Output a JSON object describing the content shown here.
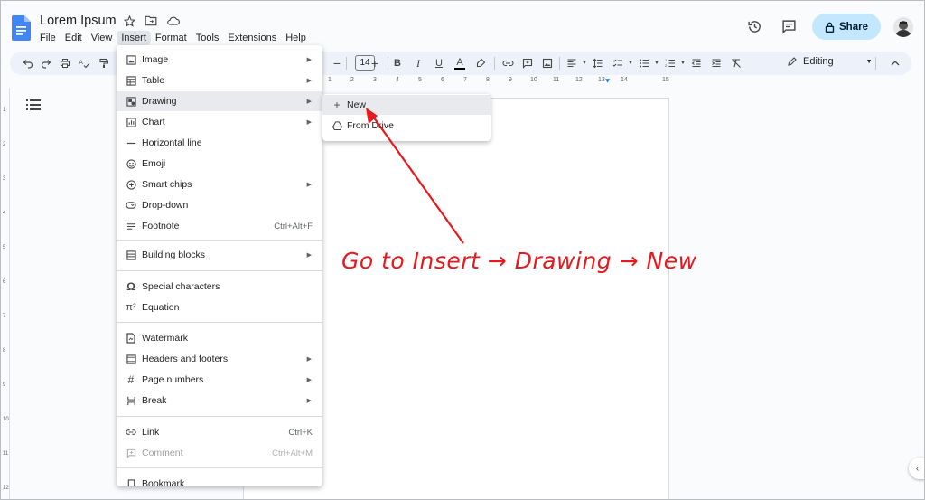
{
  "doc": {
    "title": "Lorem Ipsum"
  },
  "menubar": {
    "items": [
      "File",
      "Edit",
      "View",
      "Insert",
      "Format",
      "Tools",
      "Extensions",
      "Help"
    ],
    "active": "Insert"
  },
  "header": {
    "share_label": "Share"
  },
  "toolbar": {
    "font_size": "14",
    "bold": "B",
    "italic": "I",
    "underline": "U",
    "text_color": "A",
    "mode_label": "Editing"
  },
  "ruler": {
    "ticks": [
      "1",
      "2",
      "3",
      "4",
      "5",
      "6",
      "7",
      "8",
      "9",
      "10",
      "11",
      "12",
      "13",
      "14",
      "15"
    ],
    "left_ticks": [
      "1",
      "2",
      "3",
      "4",
      "5",
      "6",
      "7",
      "8",
      "9",
      "10",
      "11",
      "12"
    ]
  },
  "insert_menu": {
    "items": [
      {
        "label": "Image",
        "icon": "image-icon",
        "submenu": true
      },
      {
        "label": "Table",
        "icon": "table-icon",
        "submenu": true
      },
      {
        "label": "Drawing",
        "icon": "drawing-icon",
        "submenu": true,
        "highlighted": true
      },
      {
        "label": "Chart",
        "icon": "chart-icon",
        "submenu": true
      },
      {
        "label": "Horizontal line",
        "icon": "horizontal-line-icon"
      },
      {
        "label": "Emoji",
        "icon": "emoji-icon"
      },
      {
        "label": "Smart chips",
        "icon": "smart-chips-icon",
        "submenu": true
      },
      {
        "label": "Drop-down",
        "icon": "dropdown-icon"
      },
      {
        "label": "Footnote",
        "icon": "footnote-icon",
        "shortcut": "Ctrl+Alt+F"
      },
      {
        "label": "Building blocks",
        "icon": "building-blocks-icon",
        "submenu": true
      },
      {
        "label": "Special characters",
        "icon": "omega-icon"
      },
      {
        "label": "Equation",
        "icon": "pi-icon"
      },
      {
        "label": "Watermark",
        "icon": "watermark-icon"
      },
      {
        "label": "Headers and footers",
        "icon": "headers-footers-icon",
        "submenu": true
      },
      {
        "label": "Page numbers",
        "icon": "hash-icon",
        "submenu": true
      },
      {
        "label": "Break",
        "icon": "break-icon",
        "submenu": true
      },
      {
        "label": "Link",
        "icon": "link-icon",
        "shortcut": "Ctrl+K"
      },
      {
        "label": "Comment",
        "icon": "comment-icon",
        "shortcut": "Ctrl+Alt+M",
        "disabled": true
      },
      {
        "label": "Bookmark",
        "icon": "bookmark-icon"
      }
    ]
  },
  "drawing_submenu": {
    "items": [
      {
        "label": "New",
        "icon": "plus-icon",
        "highlighted": true
      },
      {
        "label": "From Drive",
        "icon": "drive-icon"
      }
    ]
  },
  "annotation": {
    "text": "Go to Insert → Drawing → New",
    "color": "#e8181d"
  },
  "colors": {
    "share_bg": "#c2e7ff",
    "toolbar_bg": "#edf2fa",
    "docs_blue": "#4285f4"
  }
}
